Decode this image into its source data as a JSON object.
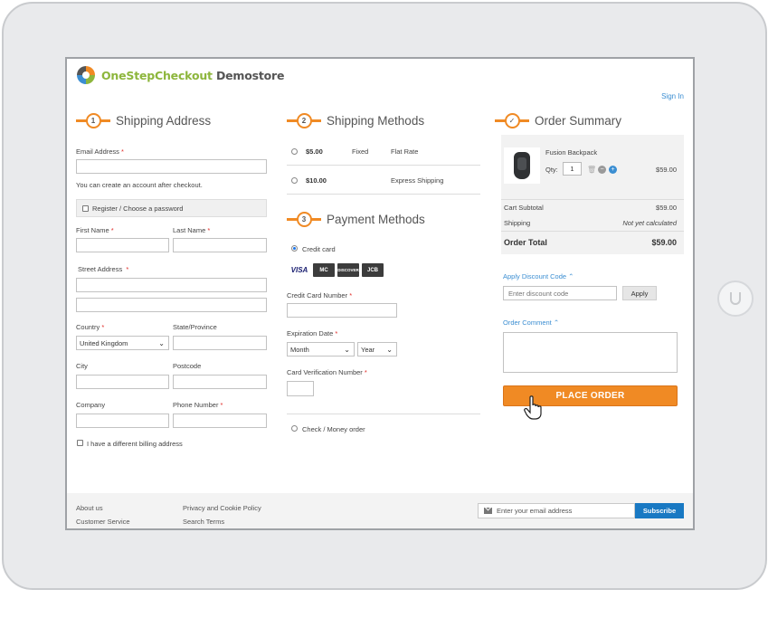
{
  "header": {
    "logo_part1": "OneStepCheckout",
    "logo_part2": " Demostore",
    "signin": "Sign In"
  },
  "sections": {
    "shipping_address": {
      "num": "1",
      "title": "Shipping Address"
    },
    "shipping_methods": {
      "num": "2",
      "title": "Shipping Methods"
    },
    "payment_methods": {
      "num": "3",
      "title": "Payment Methods"
    },
    "order_summary": {
      "num": "✓",
      "title": "Order Summary"
    }
  },
  "address": {
    "email_label": "Email Address",
    "email_note": "You can create an account after checkout.",
    "register_label": "Register / Choose a password",
    "first_name": "First Name",
    "last_name": "Last Name",
    "street": "Street Address",
    "country": "Country",
    "country_value": "United Kingdom",
    "state": "State/Province",
    "city": "City",
    "postcode": "Postcode",
    "company": "Company",
    "phone": "Phone Number",
    "billing": "I have a different billing address",
    "required_mark": "*"
  },
  "shipping_methods": [
    {
      "price": "$5.00",
      "method": "Fixed",
      "carrier": "Flat Rate"
    },
    {
      "price": "$10.00",
      "method": "",
      "carrier": "Express Shipping"
    }
  ],
  "payment": {
    "credit_card": "Credit card",
    "cards": [
      "VISA",
      "MC",
      "DISCOVER",
      "JCB"
    ],
    "cc_number": "Credit Card Number",
    "expiration": "Expiration Date",
    "month": "Month",
    "year": "Year",
    "cvv": "Card Verification Number",
    "check": "Check / Money order"
  },
  "summary": {
    "product_name": "Fusion Backpack",
    "qty_label": "Qty:",
    "qty_value": "1",
    "product_price": "$59.00",
    "subtotal_label": "Cart Subtotal",
    "subtotal_value": "$59.00",
    "shipping_label": "Shipping",
    "shipping_value": "Not yet calculated",
    "total_label": "Order Total",
    "total_value": "$59.00"
  },
  "discount": {
    "link": "Apply Discount Code",
    "placeholder": "Enter discount code",
    "apply": "Apply"
  },
  "comment": {
    "link": "Order Comment"
  },
  "place_order": "PLACE ORDER",
  "footer": {
    "links": [
      "About us",
      "Customer Service",
      "Privacy and Cookie Policy",
      "Search Terms"
    ],
    "newsletter_placeholder": "Enter your email address",
    "subscribe": "Subscribe"
  },
  "colors": {
    "accent": "#f08a24",
    "link": "#3b8ed2",
    "subscribe": "#1979c3",
    "logo_green": "#8db63c"
  }
}
